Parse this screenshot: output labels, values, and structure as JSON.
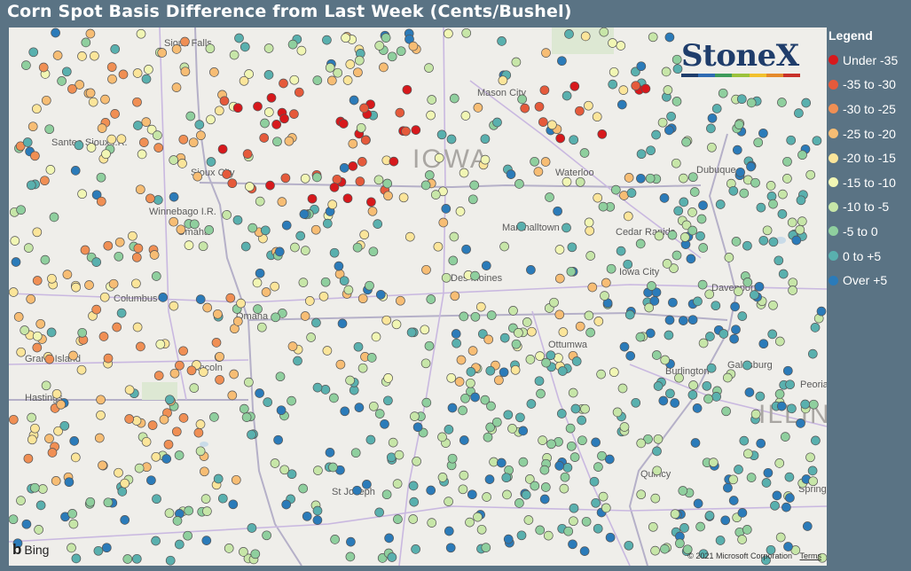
{
  "title": "Corn Spot Basis Difference from Last Week (Cents/Bushel)",
  "legend": {
    "title": "Legend",
    "items": [
      {
        "label": "Under -35",
        "color": "#d7191c"
      },
      {
        "label": "-35 to -30",
        "color": "#e55a3b"
      },
      {
        "label": "-30 to -25",
        "color": "#f08f54"
      },
      {
        "label": "-25 to -20",
        "color": "#f7bd74"
      },
      {
        "label": "-20 to -15",
        "color": "#fbe59a"
      },
      {
        "label": "-15 to -10",
        "color": "#f1f6b4"
      },
      {
        "label": "-10 to -5",
        "color": "#c7e6a8"
      },
      {
        "label": "-5 to 0",
        "color": "#8fcf9e"
      },
      {
        "label": "0 to +5",
        "color": "#59b0ae"
      },
      {
        "label": "Over +5",
        "color": "#2b7bb9"
      }
    ]
  },
  "logo": {
    "text": "StoneX",
    "tm": "TM",
    "bar_colors": [
      "#1f3d6b",
      "#2f6bb2",
      "#3e9b5a",
      "#9cc23b",
      "#f2c12e",
      "#e58a2c",
      "#c8312a"
    ]
  },
  "map": {
    "state_labels": [
      "IOWA",
      "ILLINOIS"
    ],
    "city_labels": [
      "Sioux Falls",
      "Mason City",
      "Santee Sioux I.R.",
      "Sioux City",
      "Waterloo",
      "Dubuque",
      "Winnebago I.R.",
      "Omaha",
      "Marshalltown",
      "Cedar Rapids",
      "Columbus",
      "Des Moines",
      "Iowa City",
      "Davenport",
      "Omaha",
      "Grand Island",
      "Ottumwa",
      "Galesburg",
      "Lincoln",
      "Burlington",
      "Peoria",
      "Hastings",
      "Quincy",
      "St Joseph",
      "Springfield"
    ],
    "attribution": "Bing",
    "copyright": "© 2021 Microsoft Corporation",
    "terms": "Terms"
  }
}
